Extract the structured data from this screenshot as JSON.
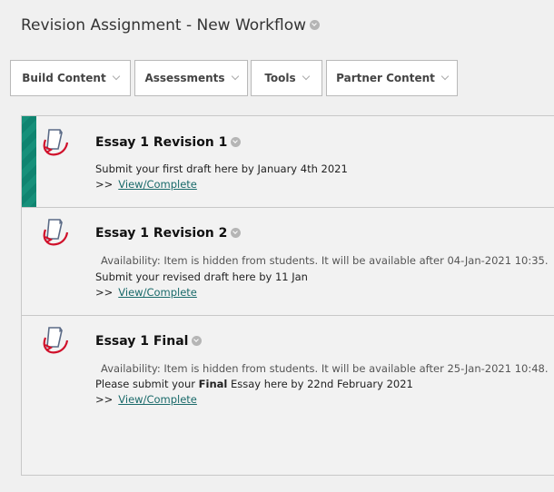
{
  "page": {
    "title": "Revision Assignment - New Workflow"
  },
  "toolbar": {
    "items": [
      {
        "label": "Build Content"
      },
      {
        "label": "Assessments"
      },
      {
        "label": "Tools"
      },
      {
        "label": "Partner Content"
      }
    ]
  },
  "items": [
    {
      "title": "Essay 1 Revision 1",
      "description": "Submit your first draft here by January 4th 2021",
      "link_prefix": ">>",
      "link_label": "View/Complete",
      "accent_color": "#16907a"
    },
    {
      "title": "Essay 1 Revision 2",
      "availability": "Availability:   Item is hidden from students. It will be available after 04-Jan-2021 10:35.",
      "description": "Submit your revised draft here by 11 Jan",
      "link_prefix": ">>",
      "link_label": "View/Complete"
    },
    {
      "title": "Essay 1 Final",
      "availability": "Availability:   Item is hidden from students. It will be available after 25-Jan-2021 10:48.",
      "description_before": "Please submit your",
      "description_bold": "Final",
      "description_after": "Essay here by 22nd February 2021",
      "link_prefix": ">>",
      "link_label": "View/Complete"
    }
  ]
}
